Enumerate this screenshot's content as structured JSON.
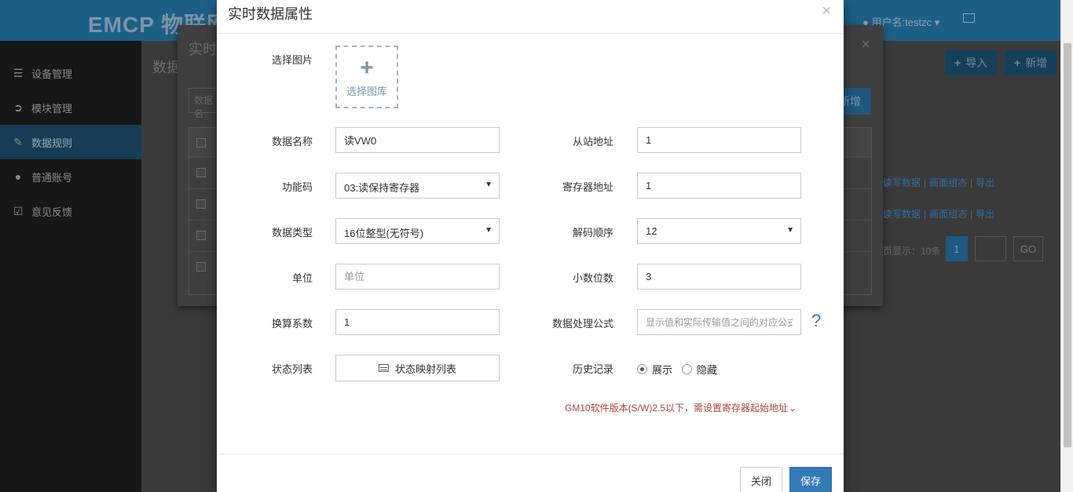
{
  "app": {
    "brand": "EMCP 物联网",
    "user": "用户名:testzc",
    "sidebar": [
      {
        "label": "设备管理",
        "icon": "list-icon"
      },
      {
        "label": "模块管理",
        "icon": "login-icon"
      },
      {
        "label": "数据规则",
        "icon": "pencil-icon",
        "active": true
      },
      {
        "label": "普通账号",
        "icon": "user-icon"
      },
      {
        "label": "意见反馈",
        "icon": "edit-icon"
      }
    ],
    "page_title": "数据",
    "import_label": "导入",
    "add_label": "新增"
  },
  "bg_modal": {
    "title": "实时",
    "search_placeholder": "数据名",
    "add_label": "新增",
    "row_links": [
      "读写数据",
      "画面组态",
      "导出"
    ],
    "pager_text": "页显示：10条",
    "page_num": "1",
    "go_label": "GO"
  },
  "modal": {
    "title": "实时数据属性",
    "image": {
      "label": "选择图片",
      "button": "选择图库"
    },
    "fields": {
      "data_name": {
        "label": "数据名称",
        "value": "读VW0"
      },
      "slave_addr": {
        "label": "从站地址",
        "value": "1"
      },
      "func_code": {
        "label": "功能码",
        "value": "03:读保持寄存器"
      },
      "reg_addr": {
        "label": "寄存器地址",
        "value": "1"
      },
      "data_type": {
        "label": "数据类型",
        "value": "16位整型(无符号)"
      },
      "decode_order": {
        "label": "解码顺序",
        "value": "12"
      },
      "unit": {
        "label": "单位",
        "placeholder": "单位"
      },
      "decimals": {
        "label": "小数位数",
        "value": "3"
      },
      "factor": {
        "label": "换算系数",
        "value": "1"
      },
      "formula": {
        "label": "数据处理公式",
        "placeholder": "显示值和实际传输值之间的对应公式"
      },
      "state_list": {
        "label": "状态列表",
        "button": "状态映射列表"
      },
      "history": {
        "label": "历史记录",
        "options": [
          "展示",
          "隐藏"
        ],
        "selected": "展示"
      }
    },
    "help": "?",
    "warning": "GM10软件版本(S/W)2.5以下，需设置寄存器起始地址",
    "close_label": "关闭",
    "save_label": "保存"
  }
}
